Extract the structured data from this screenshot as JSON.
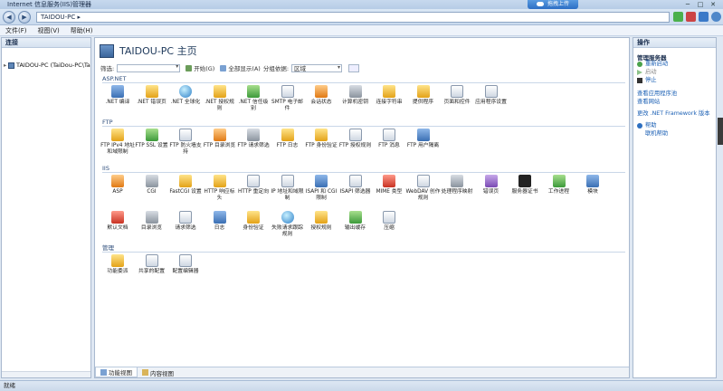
{
  "window": {
    "title": "Internet 信息服务(IIS)管理器",
    "upload_label": "拖拽上传",
    "min": "─",
    "max": "□",
    "close": "✕"
  },
  "address": {
    "crumb": "TAIDOU-PC ▸"
  },
  "menu": [
    "文件(F)",
    "视图(V)",
    "帮助(H)"
  ],
  "left": {
    "header": "连接",
    "tree_item": "TAIDOU-PC (TaiDou-PC\\Ta"
  },
  "center": {
    "title": "TAIDOU-PC 主页",
    "filter_label": "筛选:",
    "start_btn": "开始(G)",
    "show_all_btn": "全部显示(A)",
    "group_label": "分组依据:",
    "group_value": "区域",
    "sections": [
      {
        "label": "ASP.NET",
        "items": [
          ".NET 编译",
          ".NET 错误页",
          ".NET 全球化",
          ".NET 授权规则",
          ".NET 信任级别",
          "SMTP 电子邮件",
          "会话状态",
          "计算机密钥",
          "连接字符串",
          "提供程序",
          "页面和控件",
          "应用程序设置"
        ]
      },
      {
        "label": "FTP",
        "items": [
          "FTP IPv4 地址和域限制",
          "FTP SSL 设置",
          "FTP 防火墙支持",
          "FTP 目录浏览",
          "FTP 请求筛选",
          "FTP 日志",
          "FTP 身份验证",
          "FTP 授权规则",
          "FTP 消息",
          "FTP 用户隔离"
        ]
      },
      {
        "label": "IIS",
        "items": [
          "ASP",
          "CGI",
          "FastCGI 设置",
          "HTTP 响应标头",
          "HTTP 重定向",
          "IP 地址和域限制",
          "ISAPI 和 CGI 限制",
          "ISAPI 筛选器",
          "MIME 类型",
          "WebDAV 创作规则",
          "处理程序映射",
          "错误页",
          "服务器证书",
          "工作进程",
          "模块",
          "默认文档",
          "目录浏览",
          "请求筛选",
          "日志",
          "身份验证",
          "失败请求跟踪规则",
          "授权规则",
          "输出缓存",
          "压缩"
        ]
      },
      {
        "label": "管理",
        "items": [
          "功能委派",
          "共享的配置",
          "配置编辑器"
        ]
      }
    ],
    "tabs": [
      "功能视图",
      "内容视图"
    ]
  },
  "right": {
    "header": "操作",
    "manage_section": "管理服务器",
    "actions": [
      "重新启动",
      "启动",
      "停止"
    ],
    "links": [
      "查看应用程序池",
      "查看网站",
      "更改 .NET Framework 版本"
    ],
    "help": [
      "帮助",
      "联机帮助"
    ]
  },
  "status": {
    "text": "就绪"
  }
}
